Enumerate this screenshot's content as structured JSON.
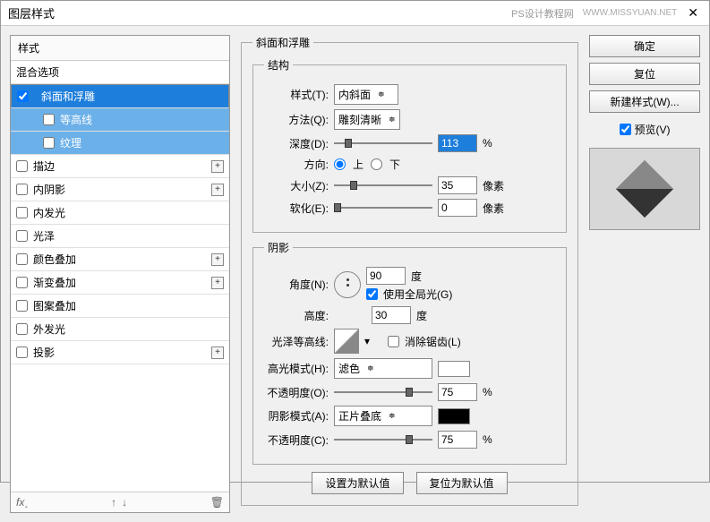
{
  "title": "图层样式",
  "brand": "PS设计教程网",
  "url": "WWW.MISSYUAN.NET",
  "styles": {
    "header": "样式",
    "blend": "混合选项",
    "bevel": "斜面和浮雕",
    "contour": "等高线",
    "texture": "纹理",
    "stroke": "描边",
    "innerShadow": "内阴影",
    "innerGlow": "内发光",
    "satin": "光泽",
    "colorOverlay": "颜色叠加",
    "gradientOverlay": "渐变叠加",
    "patternOverlay": "图案叠加",
    "outerGlow": "外发光",
    "dropShadow": "投影"
  },
  "panel": {
    "mainTitle": "斜面和浮雕",
    "structTitle": "结构",
    "styleLbl": "样式(T):",
    "styleVal": "内斜面",
    "methodLbl": "方法(Q):",
    "methodVal": "雕刻清晰",
    "depthLbl": "深度(D):",
    "depthVal": "113",
    "depthUnit": "%",
    "dirLbl": "方向:",
    "dirUp": "上",
    "dirDown": "下",
    "sizeLbl": "大小(Z):",
    "sizeVal": "35",
    "sizeUnit": "像素",
    "softenLbl": "软化(E):",
    "softenVal": "0",
    "softenUnit": "像素",
    "shadingTitle": "阴影",
    "angleLbl": "角度(N):",
    "angleVal": "90",
    "angleUnit": "度",
    "globalLight": "使用全局光(G)",
    "altLbl": "高度:",
    "altVal": "30",
    "altUnit": "度",
    "glossLbl": "光泽等高线:",
    "antiAlias": "消除锯齿(L)",
    "hiliteLbl": "高光模式(H):",
    "hiliteVal": "滤色",
    "opac1Lbl": "不透明度(O):",
    "opac1Val": "75",
    "opacUnit": "%",
    "shadowLbl": "阴影模式(A):",
    "shadowVal": "正片叠底",
    "opac2Lbl": "不透明度(C):",
    "opac2Val": "75",
    "resetDef": "设置为默认值",
    "restoreDef": "复位为默认值"
  },
  "right": {
    "ok": "确定",
    "cancel": "复位",
    "newStyle": "新建样式(W)...",
    "preview": "预览(V)"
  },
  "footer": {
    "fx": "fx"
  }
}
